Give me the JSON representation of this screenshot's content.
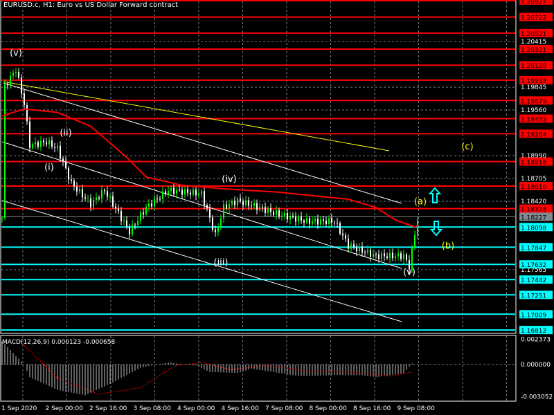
{
  "header": {
    "title": "EURUSD.c, H1:  Euro vs US Dollar Forward contract"
  },
  "colors": {
    "bull": "#00ff00",
    "bear": "#ffffff",
    "resistance": "#ff0000",
    "support": "#00ffff",
    "ma": "#ff0000",
    "yellow_line": "#ffff00",
    "current": "#808890",
    "wave_label": "#ffffff",
    "wave_label_alt": "#ffff00"
  },
  "chart_data": [
    {
      "type": "candlestick",
      "title": "EURUSD.c, H1",
      "ylim": [
        1.166,
        1.2105
      ],
      "price_ticks": [
        "1.20415",
        "1.19845",
        "1.19560",
        "1.18990",
        "1.18705",
        "1.18420",
        "1.17565"
      ],
      "resistance_levels": [
        "1.20927",
        "1.20722",
        "1.20521",
        "1.20321",
        "1.20120",
        "1.19933",
        "1.19679",
        "1.19452",
        "1.19264",
        "1.18916",
        "1.18610",
        "1.18328"
      ],
      "support_levels": [
        "1.18098",
        "1.17847",
        "1.17632",
        "1.17442",
        "1.17251",
        "1.17009",
        "1.16812"
      ],
      "current_price": "1.18227",
      "x_labels": [
        "1 Sep 2020",
        "2 Sep 00:00",
        "2 Sep 16:00",
        "3 Sep 08:00",
        "4 Sep 00:00",
        "4 Sep 16:00",
        "7 Sep 08:00",
        "8 Sep 00:00",
        "8 Sep 16:00",
        "9 Sep 08:00"
      ],
      "price_path": [
        [
          1,
          1.19854
        ],
        [
          5,
          1.2007
        ],
        [
          8,
          1.19638
        ],
        [
          10,
          1.1912
        ],
        [
          16,
          1.19163
        ],
        [
          20,
          1.19077
        ],
        [
          25,
          1.18645
        ],
        [
          32,
          1.18385
        ],
        [
          37,
          1.18558
        ],
        [
          46,
          1.1804
        ],
        [
          52,
          1.18342
        ],
        [
          60,
          1.18558
        ],
        [
          72,
          1.18515
        ],
        [
          77,
          1.17997
        ],
        [
          80,
          1.18342
        ],
        [
          85,
          1.18429
        ],
        [
          100,
          1.18256
        ],
        [
          110,
          1.1817
        ],
        [
          120,
          1.1817
        ],
        [
          125,
          1.17867
        ],
        [
          135,
          1.17737
        ],
        [
          145,
          1.17737
        ],
        [
          147,
          1.17608
        ],
        [
          150,
          1.18213
        ]
      ],
      "moving_average": [
        [
          0,
          1.19486
        ],
        [
          8,
          1.19573
        ],
        [
          20,
          1.1953
        ],
        [
          32,
          1.19357
        ],
        [
          45,
          1.18968
        ],
        [
          52,
          1.18724
        ],
        [
          65,
          1.1862
        ],
        [
          80,
          1.18576
        ],
        [
          100,
          1.18533
        ],
        [
          112,
          1.1849
        ],
        [
          125,
          1.18446
        ],
        [
          135,
          1.18342
        ],
        [
          142,
          1.18187
        ],
        [
          149,
          1.181
        ],
        [
          150,
          1.18117
        ]
      ],
      "wave_labels": [
        {
          "text": "(v)",
          "bar": 5,
          "price": 1.2024,
          "style": "white"
        },
        {
          "text": "(ii)",
          "bar": 23,
          "price": 1.1924,
          "style": "white"
        },
        {
          "text": "(i)",
          "bar": 17,
          "price": 1.1881,
          "style": "white"
        },
        {
          "text": "(iv)",
          "bar": 82,
          "price": 1.1866,
          "style": "white"
        },
        {
          "text": "(iii)",
          "bar": 79,
          "price": 1.1762,
          "style": "white"
        },
        {
          "text": "(v)",
          "bar": 147,
          "price": 1.175,
          "style": "white"
        },
        {
          "text": "(a)",
          "bar": 151,
          "price": 1.1838,
          "style": "yellow"
        },
        {
          "text": "(b)",
          "bar": 161,
          "price": 1.1783,
          "style": "yellow"
        },
        {
          "text": "(c)",
          "bar": 168,
          "price": 1.1907,
          "style": "yellow"
        }
      ]
    },
    {
      "type": "bar",
      "title": "MACD(12,26,9) 0.000123 -0.000658",
      "ylim": [
        -0.003052,
        0.002373
      ],
      "y_ticks": [
        "0.002373",
        "0.000000",
        "-0.003052"
      ],
      "histogram_path": [
        [
          0,
          0.0022
        ],
        [
          16,
          0.0
        ],
        [
          20,
          -0.0012
        ],
        [
          40,
          -0.0024
        ],
        [
          60,
          -0.0029
        ],
        [
          80,
          -0.0017
        ],
        [
          100,
          -0.0003
        ],
        [
          120,
          0.0002
        ],
        [
          140,
          -0.0001
        ],
        [
          150,
          -0.0007
        ],
        [
          170,
          -0.0008
        ],
        [
          180,
          -0.0004
        ],
        [
          200,
          -0.0008
        ],
        [
          215,
          -0.0011
        ],
        [
          240,
          -0.001
        ],
        [
          260,
          -0.001
        ],
        [
          270,
          -0.0012
        ],
        [
          290,
          -0.0008
        ],
        [
          296,
          0.0001
        ]
      ],
      "signal_path": [
        [
          16,
          0.0018
        ],
        [
          40,
          -0.0013
        ],
        [
          70,
          -0.0028
        ],
        [
          100,
          -0.0022
        ],
        [
          125,
          -0.0001
        ],
        [
          145,
          0.0002
        ],
        [
          165,
          -0.0005
        ],
        [
          190,
          -0.0001
        ],
        [
          220,
          -0.0006
        ],
        [
          250,
          -0.0007
        ],
        [
          280,
          -0.0011
        ],
        [
          296,
          -0.0007
        ]
      ]
    }
  ]
}
